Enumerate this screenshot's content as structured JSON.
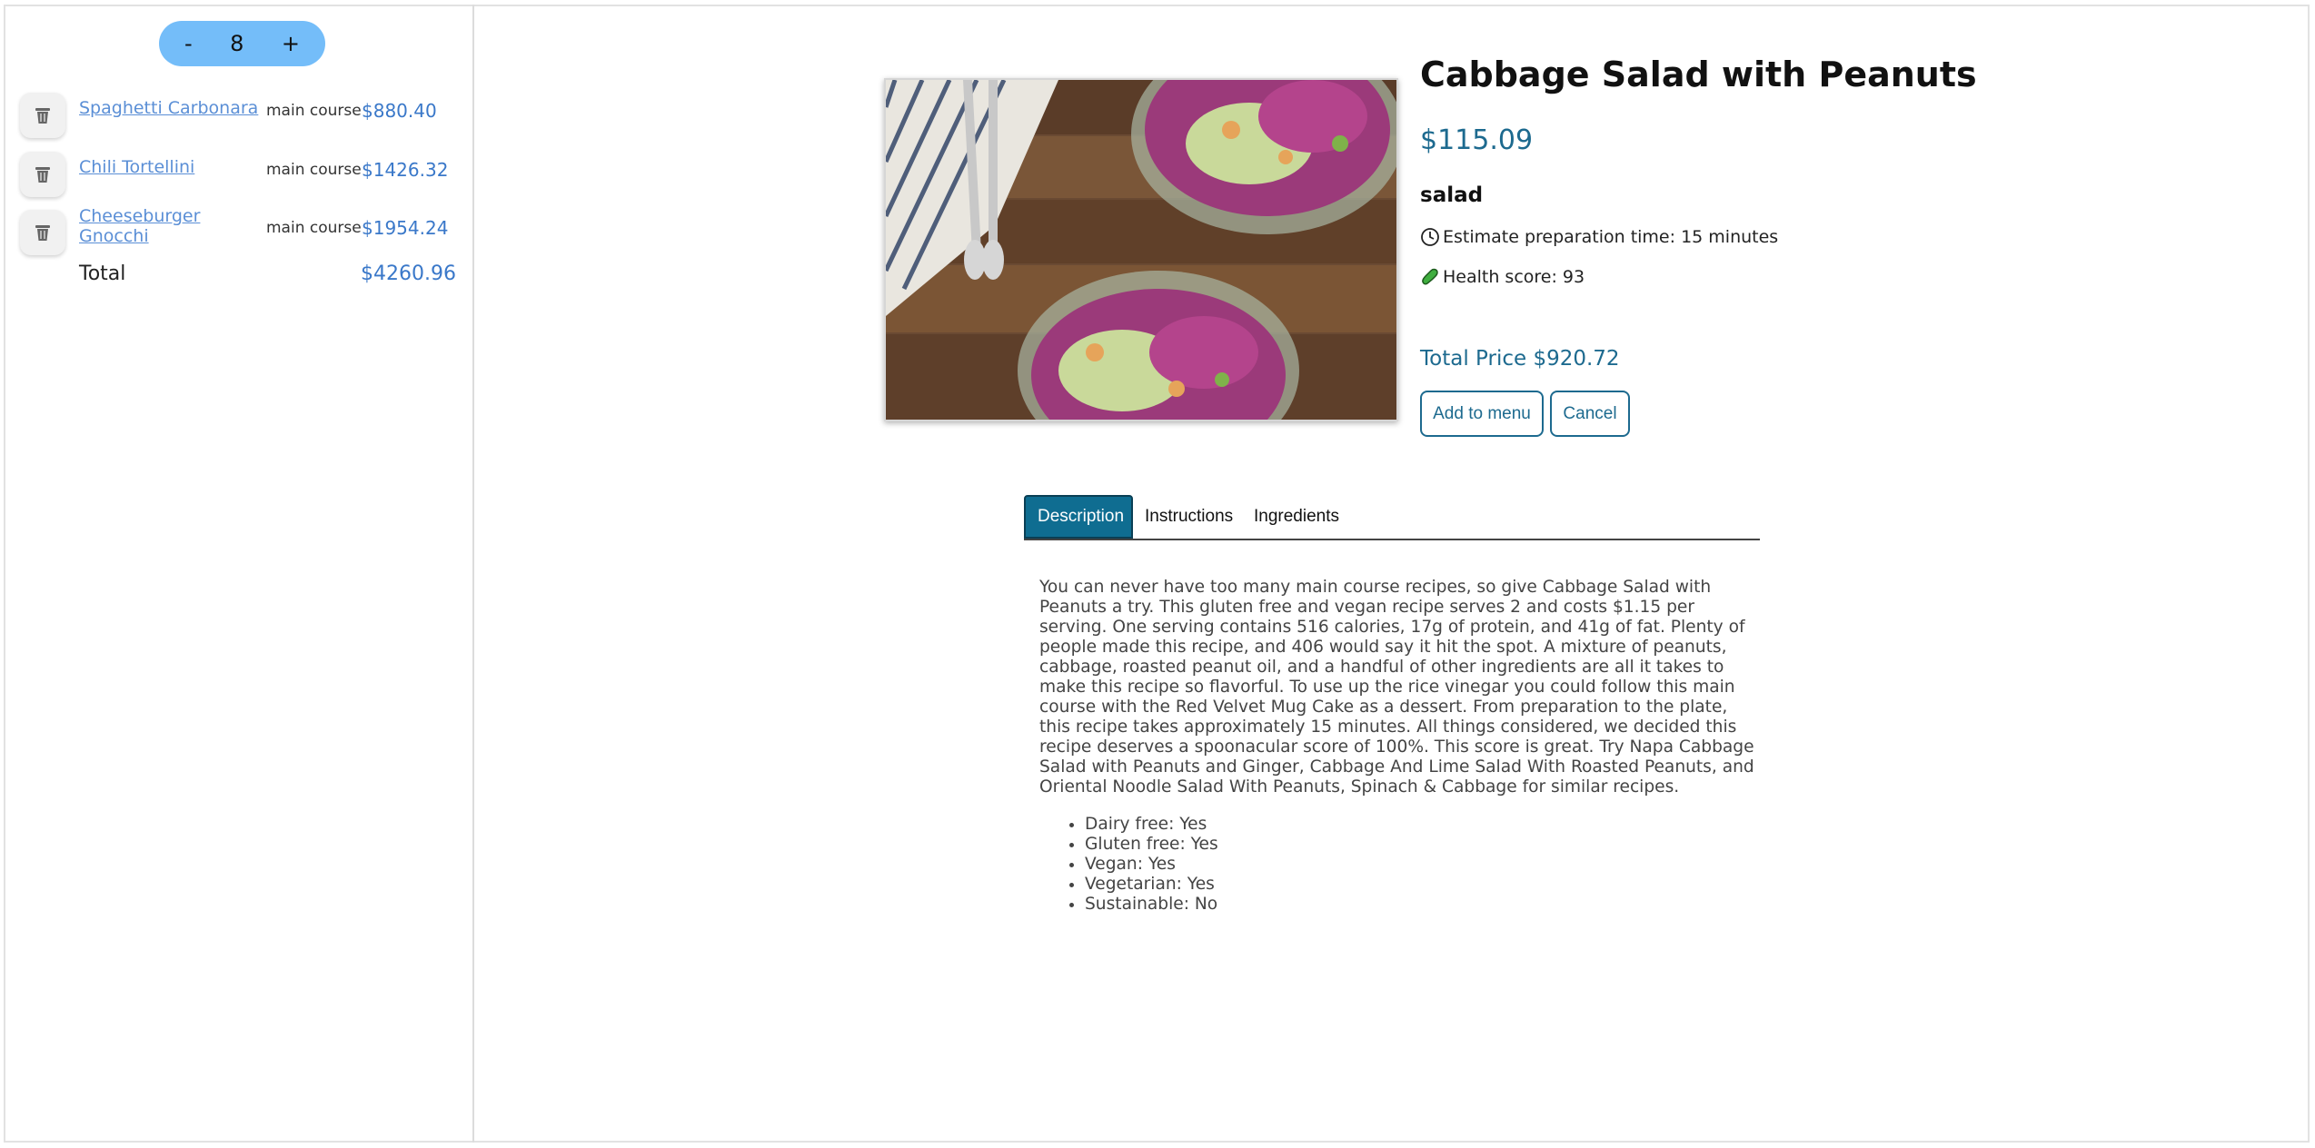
{
  "sidebar": {
    "stepper": {
      "minus": "-",
      "value": "8",
      "plus": "+"
    },
    "items": [
      {
        "name": "Spaghetti Carbonara",
        "category": "main course",
        "price": "$880.40"
      },
      {
        "name": "Chili Tortellini",
        "category": "main course",
        "price": "$1426.32"
      },
      {
        "name": "Cheeseburger Gnocchi",
        "category": "main course",
        "price": "$1954.24"
      }
    ],
    "total_label": "Total",
    "total_value": "$4260.96"
  },
  "dish": {
    "title": "Cabbage Salad with Peanuts",
    "price": "$115.09",
    "type": "salad",
    "prep_time": "Estimate preparation time: 15 minutes",
    "health_score": "Health score: 93",
    "total_price": "Total Price $920.72",
    "add_button": "Add to menu",
    "cancel_button": "Cancel"
  },
  "tabs": [
    {
      "label": "Description",
      "active": true
    },
    {
      "label": "Instructions",
      "active": false
    },
    {
      "label": "Ingredients",
      "active": false
    }
  ],
  "description": "You can never have too many main course recipes, so give Cabbage Salad with Peanuts a try. This gluten free and vegan recipe serves 2 and costs $1.15 per serving. One serving contains 516 calories, 17g of protein, and 41g of fat. Plenty of people made this recipe, and 406 would say it hit the spot. A mixture of peanuts, cabbage, roasted peanut oil, and a handful of other ingredients are all it takes to make this recipe so flavorful. To use up the rice vinegar you could follow this main course with the Red Velvet Mug Cake as a dessert. From preparation to the plate, this recipe takes approximately 15 minutes. All things considered, we decided this recipe deserves a spoonacular score of 100%. This score is great. Try Napa Cabbage Salad with Peanuts and Ginger, Cabbage And Lime Salad With Roasted Peanuts, and Oriental Noodle Salad With Peanuts, Spinach & Cabbage for similar recipes.",
  "attributes": [
    "Dairy free: Yes",
    "Gluten free: Yes",
    "Vegan: Yes",
    "Vegetarian: Yes",
    "Sustainable: No"
  ],
  "icons": {
    "trash": "trash-icon",
    "clock": "clock-icon",
    "health": "pickle-icon"
  },
  "colors": {
    "stepper_bg": "#74bdf9",
    "accent": "#1d6a8f",
    "active_tab": "#0f6d91",
    "link": "#5b8fd6",
    "price": "#3a78c9"
  }
}
